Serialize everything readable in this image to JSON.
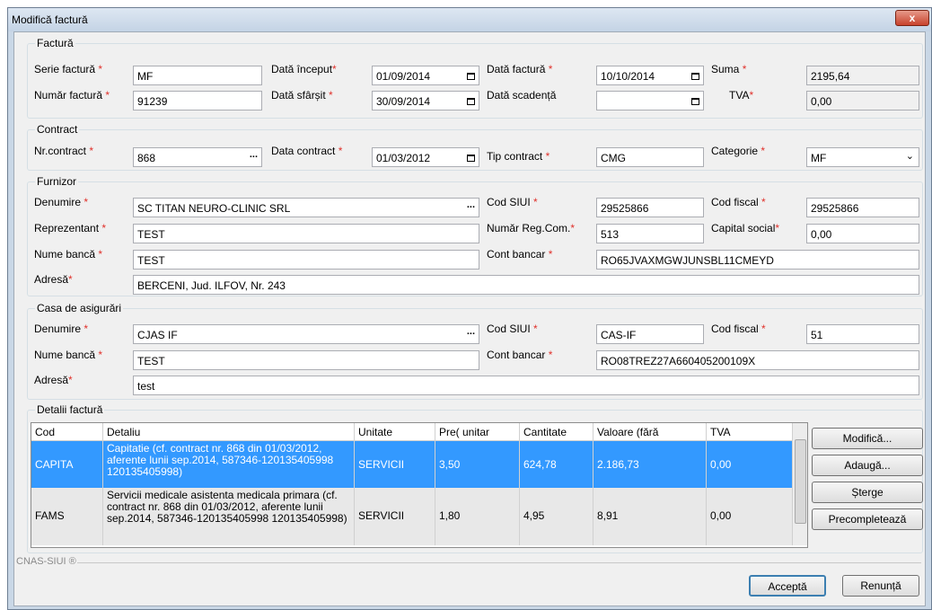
{
  "window": {
    "title": "Modifică factură",
    "close": "x"
  },
  "factura": {
    "legend": "Factură",
    "serie_label": "Serie factură",
    "serie_value": "MF",
    "numar_label": "Număr factură",
    "numar_value": "91239",
    "data_inceput_label": "Dată început",
    "data_inceput_value": "01/09/2014",
    "data_sfarsit_label": "Dată sfârșit",
    "data_sfarsit_value": "30/09/2014",
    "data_factura_label": "Dată factură",
    "data_factura_value": "10/10/2014",
    "data_scadenta_label": "Dată scadență",
    "data_scadenta_value": "",
    "suma_label": "Suma",
    "suma_value": "2195,64",
    "tva_label": "TVA",
    "tva_value": "0,00"
  },
  "contract": {
    "legend": "Contract",
    "nr_label": "Nr.contract",
    "nr_value": "868",
    "data_label": "Data contract",
    "data_value": "01/03/2012",
    "tip_label": "Tip contract",
    "tip_value": "CMG",
    "categorie_label": "Categorie",
    "categorie_value": "MF"
  },
  "furnizor": {
    "legend": "Furnizor",
    "denumire_label": "Denumire",
    "denumire_value": "SC TITAN NEURO-CLINIC SRL",
    "cod_siui_label": "Cod SIUI",
    "cod_siui_value": "29525866",
    "cod_fiscal_label": "Cod fiscal",
    "cod_fiscal_value": "29525866",
    "reprezentant_label": "Reprezentant",
    "reprezentant_value": "TEST",
    "reg_com_label": "Număr Reg.Com.",
    "reg_com_value": "513",
    "capital_label": "Capital social",
    "capital_value": "0,00",
    "banca_label": "Nume bancă",
    "banca_value": "TEST",
    "cont_label": "Cont bancar",
    "cont_value": "RO65JVAXMGWJUNSBL11CMEYD",
    "adresa_label": "Adresă",
    "adresa_value": "BERCENI, Jud. ILFOV, Nr. 243"
  },
  "casa": {
    "legend": "Casa de asigurări",
    "denumire_label": "Denumire",
    "denumire_value": "CJAS IF",
    "cod_siui_label": "Cod SIUI",
    "cod_siui_value": "CAS-IF",
    "cod_fiscal_label": "Cod fiscal",
    "cod_fiscal_value": "51",
    "banca_label": "Nume bancă",
    "banca_value": "TEST",
    "cont_label": "Cont bancar",
    "cont_value": "RO08TREZ27A660405200109X",
    "adresa_label": "Adresă",
    "adresa_value": "test"
  },
  "detalii": {
    "legend": "Detalii factură",
    "columns": [
      "Cod",
      "Detaliu",
      "Unitate",
      "Pre( unitar",
      "Cantitate",
      "Valoare (fără",
      "TVA"
    ],
    "rows": [
      {
        "cod": "CAPITA",
        "detaliu": "Capitatie (cf. contract nr. 868 din 01/03/2012, aferente lunii sep.2014, 587346-120135405998 120135405998)",
        "unitate": "SERVICII",
        "pret": "3,50",
        "cantitate": "624,78",
        "valoare": "2.186,73",
        "tva": "0,00"
      },
      {
        "cod": "FAMS",
        "detaliu": "Servicii medicale asistenta medicala primara (cf. contract nr. 868 din 01/03/2012, aferente lunii sep.2014, 587346-120135405998 120135405998)",
        "unitate": "SERVICII",
        "pret": "1,80",
        "cantitate": "4,95",
        "valoare": "8,91",
        "tva": "0,00"
      }
    ],
    "buttons": {
      "modifica": "Modifică...",
      "adauga": "Adaugă...",
      "sterge": "Șterge",
      "precompleteaza": "Precompletează"
    }
  },
  "footer": {
    "brand": "CNAS-SIUI ®",
    "accepta": "Acceptă",
    "renunta": "Renunță"
  }
}
